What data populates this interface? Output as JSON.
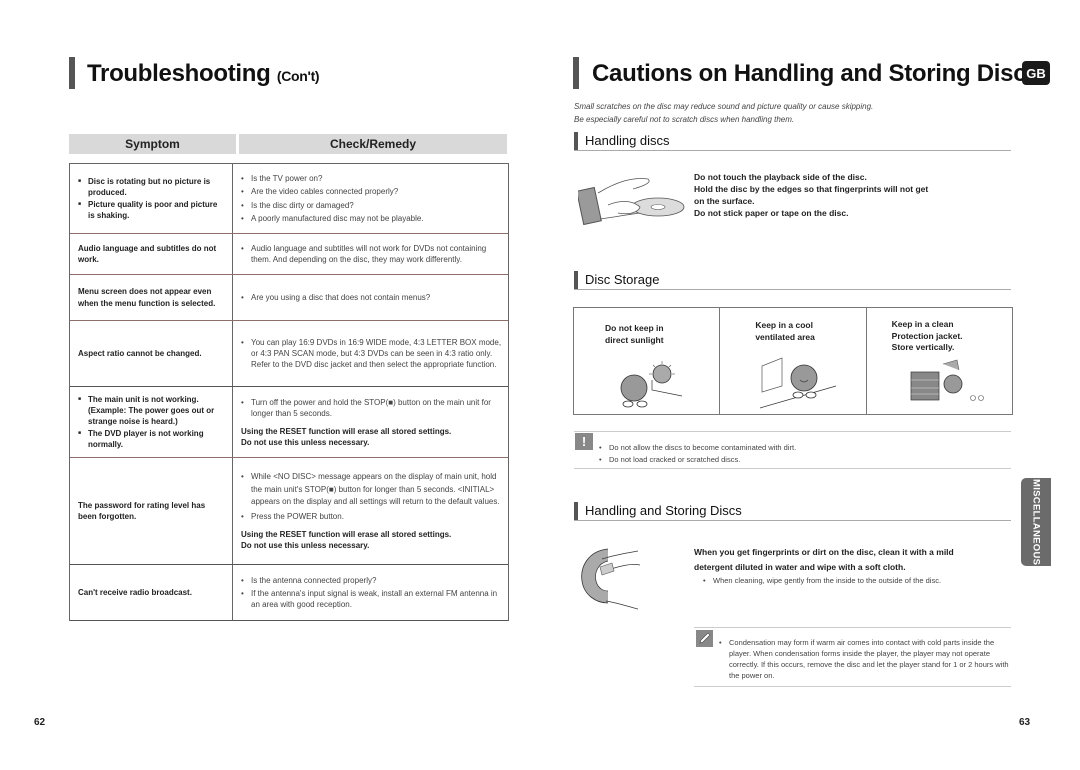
{
  "left_page": {
    "title": "Troubleshooting",
    "title_suffix": "(Con't)",
    "table": {
      "headers": [
        "Symptom",
        "Check/Remedy"
      ],
      "rows": [
        {
          "symptom_items": [
            "Disc is rotating but no picture is produced.",
            "Picture quality is poor and picture is shaking."
          ],
          "remedies": [
            "Is the TV power on?",
            "Are the video cables connected properly?",
            "Is the disc dirty or damaged?",
            "A poorly manufactured disc may not be playable."
          ]
        },
        {
          "symptom": "Audio language and subtitles do not work.",
          "remedies": [
            "Audio language and subtitles will not work for DVDs not containing them. And depending on the disc, they may work differently."
          ]
        },
        {
          "symptom": "Menu screen does not appear even when the menu function is selected.",
          "remedies": [
            "Are you using a disc that does not contain menus?"
          ]
        },
        {
          "symptom": "Aspect ratio cannot be changed.",
          "remedies": [
            "You can play 16:9 DVDs in 16:9 WIDE mode, 4:3 LETTER BOX mode, or 4:3 PAN SCAN mode, but 4:3 DVDs can be seen in 4:3 ratio only. Refer to the DVD disc jacket and then select the appropriate function."
          ]
        },
        {
          "symptom_items": [
            "The main unit is not working. (Example: The power goes out or strange noise is heard.)",
            "The DVD player is not working normally."
          ],
          "remedies": [
            "Turn off the power and hold the STOP(■) button on the main unit for longer than 5 seconds."
          ],
          "warning_lines": [
            "Using the RESET function will erase all stored settings.",
            "Do not use this unless necessary."
          ]
        },
        {
          "symptom": "The password for rating level has been forgotten.",
          "remedies": [
            "While <NO DISC> message appears on the display of main unit, hold the main unit's STOP(■) button for longer than 5 seconds. <INITIAL> appears on the display and all settings will return to the default values.",
            "Press the POWER button."
          ],
          "warning_lines": [
            "Using the RESET function will erase all stored settings.",
            "Do not use this unless necessary."
          ]
        },
        {
          "symptom": "Can't receive radio broadcast.",
          "remedies": [
            "Is the antenna connected properly?",
            "If the antenna's input signal is weak, install an external FM antenna in an area with good reception."
          ]
        }
      ]
    },
    "page_number": "62"
  },
  "right_page": {
    "title": "Cautions on Handling and Storing Discs",
    "language_badge": "GB",
    "intro": [
      "Small scratches on the disc may reduce sound and picture quality or cause skipping.",
      "Be especially careful not to scratch discs when handling them."
    ],
    "handling": {
      "heading": "Handling discs",
      "lines": [
        "Do not touch the playback side of the disc.",
        "Hold the disc by the edges so that fingerprints will not get",
        "on the surface.",
        "Do not stick paper or tape on the disc."
      ]
    },
    "storage": {
      "heading": "Disc Storage",
      "cells": [
        {
          "lines": [
            "Do not keep in",
            "direct sunlight"
          ]
        },
        {
          "lines": [
            "Keep in a cool",
            "ventilated area"
          ]
        },
        {
          "lines": [
            "Keep in a clean",
            "Protection jacket.",
            "Store vertically."
          ]
        }
      ],
      "caution_notes": [
        "Do not allow the discs to become contaminated with dirt.",
        "Do not load cracked or scratched discs."
      ]
    },
    "cleaning": {
      "heading": "Handling and Storing Discs",
      "bold_lines": [
        "When you get fingerprints or dirt on the disc, clean it with a mild",
        "detergent diluted in water and wipe with a soft cloth."
      ],
      "bullet": "When cleaning, wipe gently from the inside to the outside of the disc."
    },
    "note": "Condensation may form if warm air comes into contact with cold parts inside the player. When condensation forms inside the player, the player may not operate correctly. If this occurs, remove the disc and let the player stand for 1 or 2 hours with the power on.",
    "side_tab": "MISCELLANEOUS",
    "page_number": "63"
  }
}
